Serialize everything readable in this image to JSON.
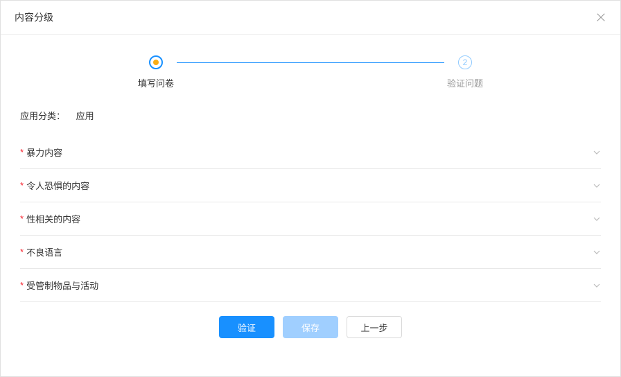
{
  "modal": {
    "title": "内容分级"
  },
  "steps": {
    "step1_label": "填写问卷",
    "step2_label": "验证问题",
    "step2_number": "2"
  },
  "category": {
    "label": "应用分类：",
    "value": "应用"
  },
  "items": [
    {
      "label": "暴力内容"
    },
    {
      "label": "令人恐惧的内容"
    },
    {
      "label": "性相关的内容"
    },
    {
      "label": "不良语言"
    },
    {
      "label": "受管制物品与活动"
    }
  ],
  "buttons": {
    "verify": "验证",
    "save": "保存",
    "prev": "上一步"
  }
}
